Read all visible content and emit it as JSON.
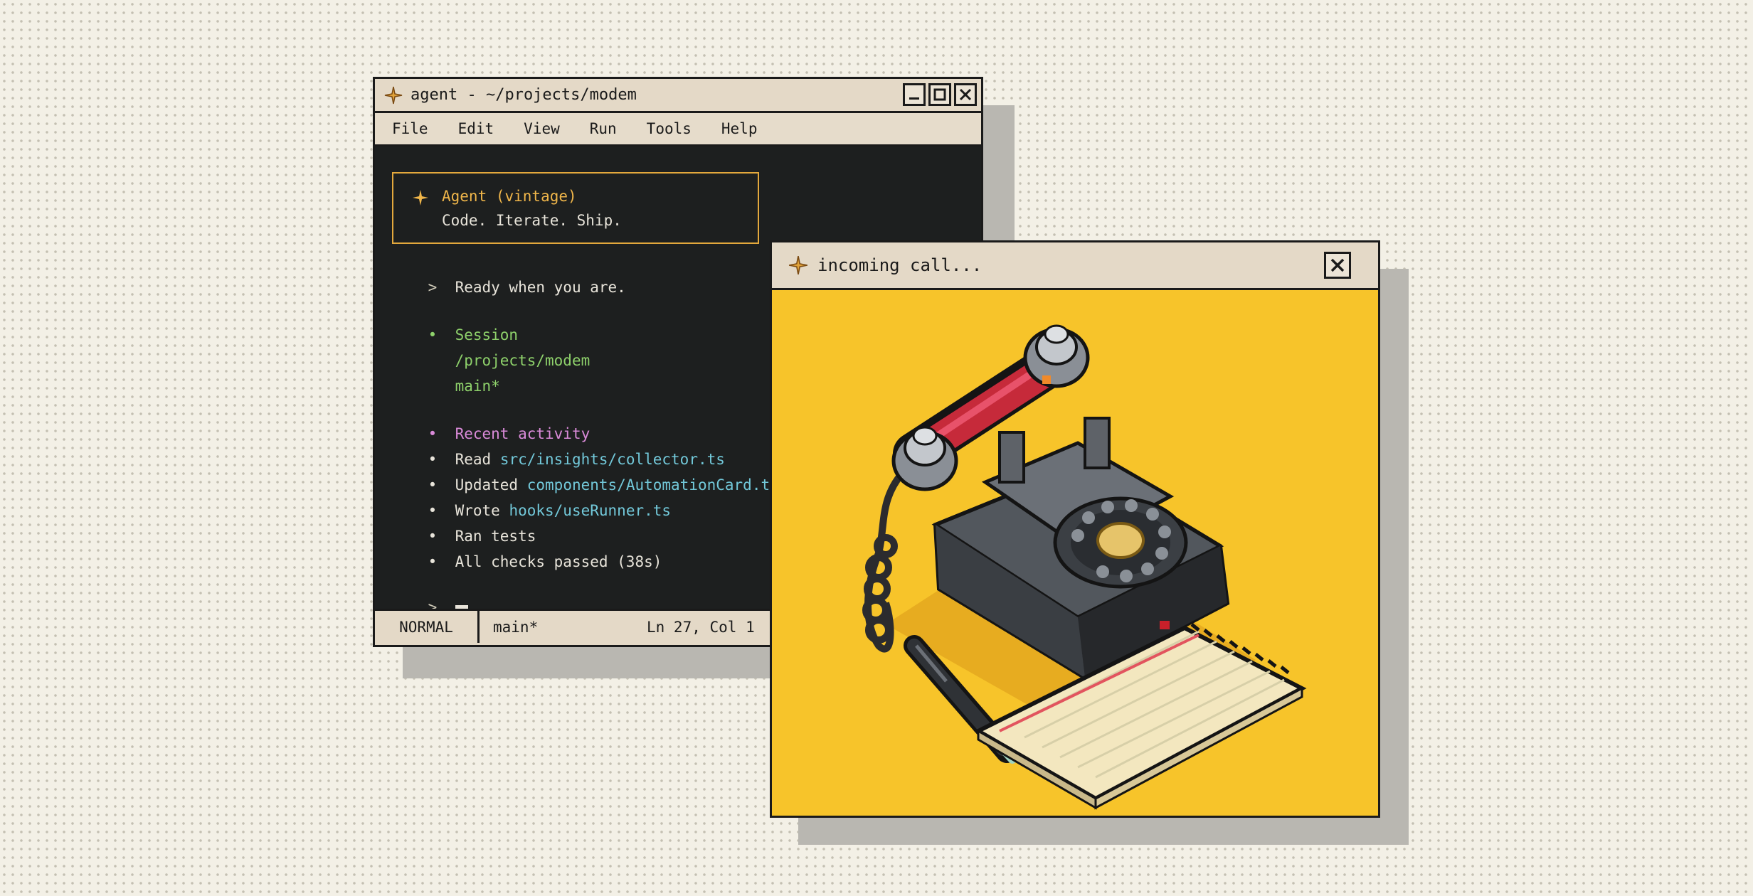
{
  "terminal": {
    "title": "agent - ~/projects/modem",
    "title_icon": "sparkle-icon",
    "window_buttons": [
      "minimize",
      "maximize",
      "close"
    ],
    "menu": [
      "File",
      "Edit",
      "View",
      "Run",
      "Tools",
      "Help"
    ],
    "banner": {
      "title": "Agent (vintage)",
      "subtitle": "Code. Iterate. Ship."
    },
    "prompt_marker": ">",
    "bullet_marker": "•",
    "ready": "Ready when you are.",
    "session": {
      "heading": "Session",
      "path": "/projects/modem",
      "branch": "main*"
    },
    "recent": {
      "heading": "Recent activity",
      "items": [
        {
          "verb": "Read",
          "target": "src/insights/collector.ts"
        },
        {
          "verb": "Updated",
          "target": "components/AutomationCard.tsx"
        },
        {
          "verb": "Wrote",
          "target": "hooks/useRunner.ts"
        },
        {
          "verb": "Ran tests",
          "target": ""
        },
        {
          "verb": "All checks passed (38s)",
          "target": ""
        }
      ]
    },
    "status": {
      "mode": "NORMAL",
      "branch": "main*",
      "position": "Ln 27, Col 1"
    },
    "colors": {
      "accent": "#f0b64a",
      "green": "#8ed16b",
      "purple": "#d98ad8",
      "cyan": "#72c8d9",
      "background": "#1d1f1f"
    }
  },
  "call_window": {
    "title": "incoming call...",
    "title_icon": "sparkle-icon",
    "close_icon": "close-icon",
    "illustration": "rotary-telephone-with-pen-and-notepad",
    "background": "#f7c42a"
  }
}
